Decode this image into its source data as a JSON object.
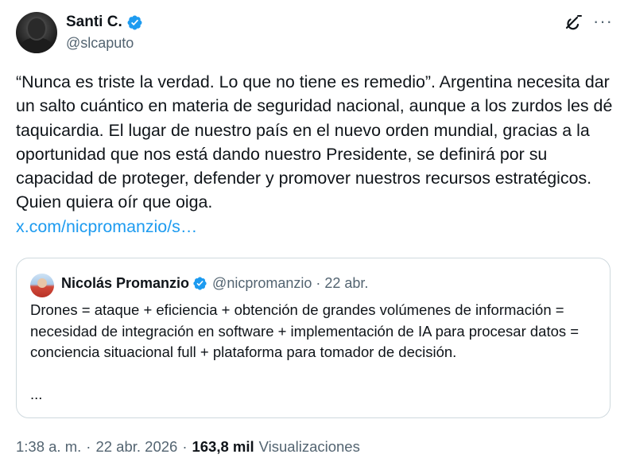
{
  "author": {
    "name": "Santi C.",
    "handle": "@slcaputo"
  },
  "tweet": {
    "text": "“Nunca es triste la verdad. Lo que no tiene es remedio”. Argentina necesita dar un salto cuántico en materia de seguridad nacional, aunque a los zurdos les dé taquicardia. El lugar de nuestro país en el nuevo orden mundial, gracias a la oportunidad que nos está dando nuestro Presidente, se definirá por su capacidad de proteger, defender y promover nuestros recursos estratégicos. Quien quiera oír que oiga.",
    "link": "x.com/nicpromanzio/s…"
  },
  "quote": {
    "name": "Nicolás Promanzio",
    "handle": "@nicpromanzio",
    "date": "22 abr.",
    "text": "Drones = ataque + eficiencia + obtención de grandes volúmenes de información = necesidad de integración en software + implementación de IA para procesar datos = conciencia situacional full + plataforma para tomador de decisión.",
    "ellipsis": "..."
  },
  "footer": {
    "time": "1:38 a. m.",
    "date": "22 abr. 2026",
    "views_count": "163,8 mil",
    "views_label": "Visualizaciones"
  },
  "icons": {
    "verified": "verified-badge-icon",
    "grok": "grok-icon",
    "more": "more-options-icon"
  },
  "colors": {
    "verified_blue": "#1d9bf0",
    "link_blue": "#1d9bf0",
    "secondary_text": "#536471",
    "primary_text": "#0f1419",
    "border": "#cfd9de"
  }
}
